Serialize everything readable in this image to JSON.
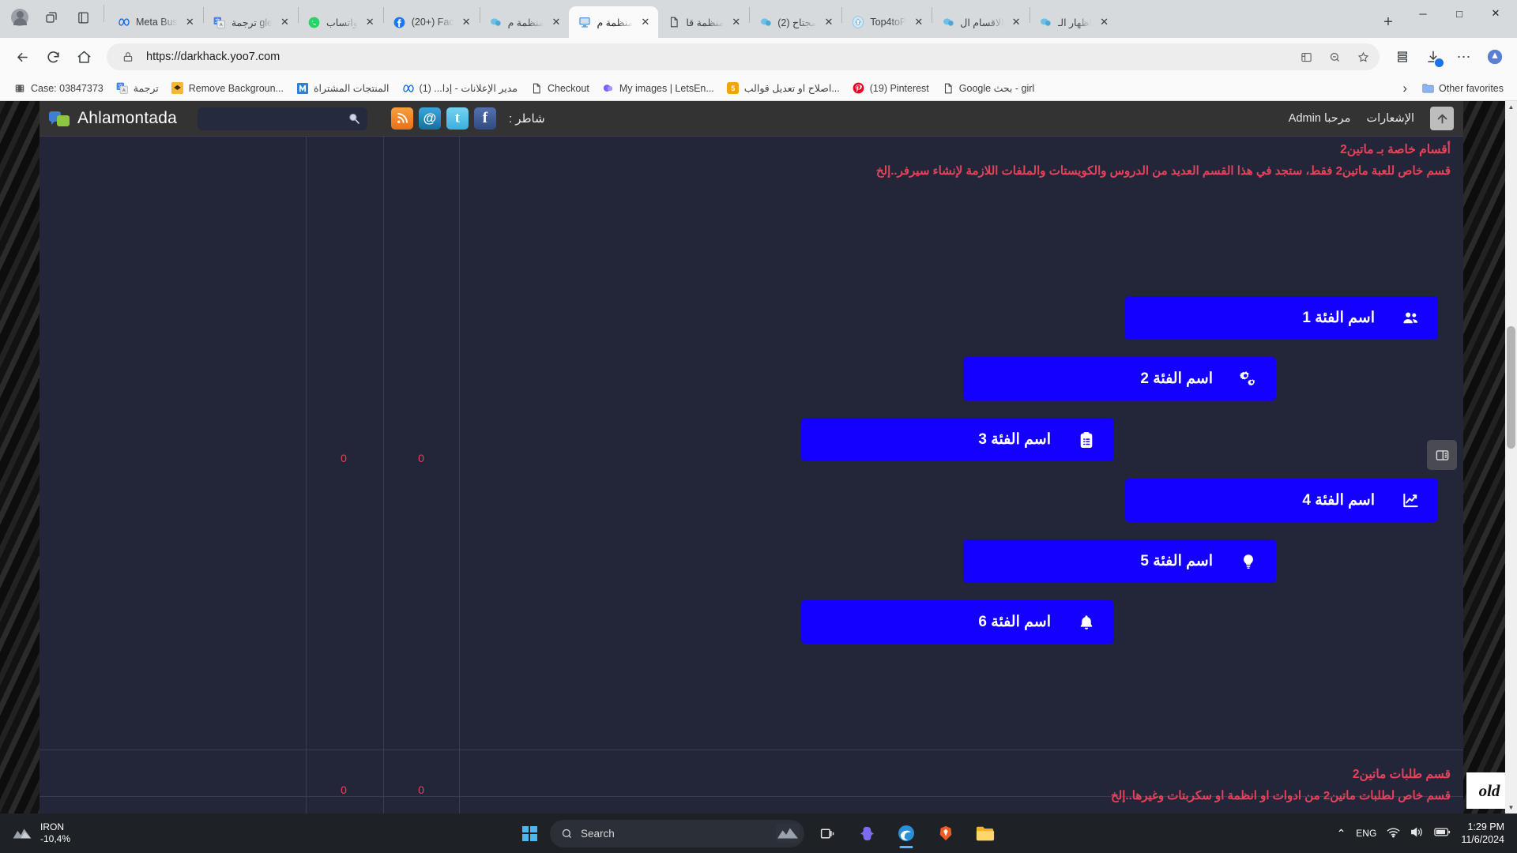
{
  "browser": {
    "tabs": [
      {
        "title": "Meta Bus",
        "favicon": "meta-icon",
        "active": false
      },
      {
        "title": "ترجمة gle",
        "favicon": "google-translate-icon",
        "active": false
      },
      {
        "title": "واتساب",
        "favicon": "whatsapp-icon",
        "active": false
      },
      {
        "title": "(20+) Fac",
        "favicon": "facebook-icon",
        "active": false
      },
      {
        "title": "منظمة م",
        "favicon": "chat-icon",
        "active": false
      },
      {
        "title": "منظمة م",
        "favicon": "monitor-icon",
        "active": true
      },
      {
        "title": "منظمة قا",
        "favicon": "document-icon",
        "active": false
      },
      {
        "title": "(2) مجتاح",
        "favicon": "chat-icon",
        "active": false
      },
      {
        "title": "Top4toP",
        "favicon": "upload-icon",
        "active": false
      },
      {
        "title": "الاقسام ال",
        "favicon": "chat-icon",
        "active": false
      },
      {
        "title": "اظهار الـ",
        "favicon": "chat-icon",
        "active": false
      }
    ],
    "new_tab_label": "+",
    "window_controls": {
      "minimize": "─",
      "maximize": "□",
      "close": "✕"
    },
    "nav": {
      "back": "←",
      "reload": "⟳",
      "home": "⌂",
      "lock_icon": "lock-icon",
      "url": "https://darkhack.yoo7.com",
      "split_icon": "⊞",
      "zoom_icon": "⌕",
      "bookmark_star": "☆",
      "extensions": "⬗",
      "downloads": "⬇",
      "more": "⋯",
      "profile": "◆"
    },
    "bookmarks": [
      {
        "label": "Case: 03847373",
        "icon": "film-icon",
        "color": "#5b5b5b"
      },
      {
        "label": "ترجمة",
        "icon": "google-translate-icon",
        "color": "#4285f4"
      },
      {
        "label": "Remove Backgroun...",
        "icon": "diamond-icon",
        "color": "#f7b733"
      },
      {
        "label": "المنتجات المشتراة",
        "icon": "m-icon",
        "color": "#2b7fd4"
      },
      {
        "label": "مدير الإعلانات - إدا... (1)",
        "icon": "meta-icon",
        "color": "#0668e1"
      },
      {
        "label": "Checkout",
        "icon": "page-icon",
        "color": "#444"
      },
      {
        "label": "My images | LetsEn...",
        "icon": "blob-icon",
        "color": "#7b61ff"
      },
      {
        "label": "اصلاح او تعديل قوالب...",
        "icon": "number-icon",
        "color": "#f0a500",
        "badge": "5"
      },
      {
        "label": "(19) Pinterest",
        "icon": "pinterest-icon",
        "color": "#e60023"
      },
      {
        "label": "Google بحث - girl",
        "icon": "page-icon",
        "color": "#444"
      }
    ],
    "overflow_label": "›",
    "other_favorites": {
      "label": "Other favorites",
      "icon": "folder-icon"
    }
  },
  "forum": {
    "brand": "Ahlamontada",
    "search_placeholder": "",
    "search_icon": "search-icon",
    "social": [
      {
        "name": "rss-icon",
        "glyph": "📶",
        "color": "#f07c1f"
      },
      {
        "name": "email-icon",
        "glyph": "@",
        "color": "#1a7cb5"
      },
      {
        "name": "twitter-icon",
        "glyph": "t",
        "color": "#4dc3ef"
      },
      {
        "name": "facebook-icon",
        "glyph": "f",
        "color": "#3b5998"
      }
    ],
    "share_label": "شاطر :",
    "notifications_label": "الإشعارات",
    "welcome_label": "مرحبا Admin",
    "scroll_top_icon": "arrow-up-icon"
  },
  "section_top": {
    "title": "أقسام خاصة بـ ماتين2",
    "description": "قسم خاص للعبة ماتين2 فقط، ستجد في هذا القسم العديد من الدروس والكويستات والملفات اللازمة لإنشاء سيرفر..إلخ",
    "topics_count": "0",
    "posts_count": "0"
  },
  "categories": [
    {
      "label": "اسم الفئة 1",
      "icon": "users-icon",
      "indent": 0
    },
    {
      "label": "اسم الفئة 2",
      "icon": "gears-icon",
      "indent": 1
    },
    {
      "label": "اسم الفئة 3",
      "icon": "clipboard-list-icon",
      "indent": 2
    },
    {
      "label": "اسم الفئة 4",
      "icon": "chart-line-icon",
      "indent": 0
    },
    {
      "label": "اسم الفئة 5",
      "icon": "lightbulb-icon",
      "indent": 1
    },
    {
      "label": "اسم الفئة 6",
      "icon": "bell-icon",
      "indent": 2
    }
  ],
  "section_bottom": {
    "title": "قسم طلبات ماتين2",
    "description": "قسم خاص لطلبات ماتين2 من ادوات او انظمة او سكربتات وغيرها..إلخ",
    "topics_count": "0",
    "posts_count": "0",
    "badge": "old"
  },
  "side_widget": {
    "icon": "panel-icon"
  },
  "taskbar": {
    "weather": {
      "icon": "weather-icon",
      "line1": "IRON",
      "line2": "-10,4%"
    },
    "start_icon": "windows-icon",
    "search_placeholder": "Search",
    "search_icon": "search-icon",
    "apps": [
      {
        "name": "task-view-icon",
        "glyph": "⧉"
      },
      {
        "name": "copilot-icon",
        "glyph": "◈"
      },
      {
        "name": "edge-icon",
        "glyph": "e",
        "active": true
      },
      {
        "name": "brave-icon",
        "glyph": "🦁"
      },
      {
        "name": "file-explorer-icon",
        "glyph": "📁"
      }
    ],
    "tray": {
      "chevron": "⌃",
      "lang": "ENG",
      "wifi": "wifi-icon",
      "volume": "volume-icon",
      "battery": "battery-icon"
    },
    "clock": {
      "time": "1:29 PM",
      "date": "11/6/2024"
    }
  }
}
